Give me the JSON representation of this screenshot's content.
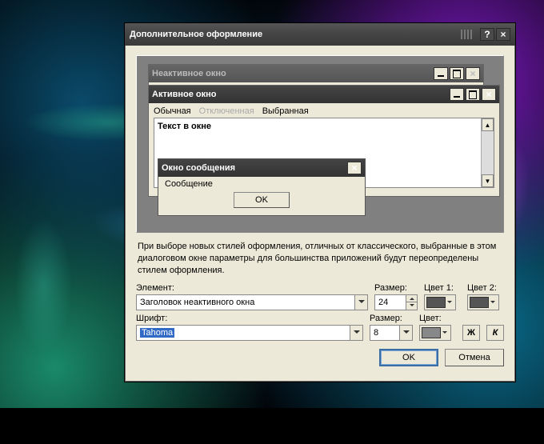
{
  "dialog": {
    "title": "Дополнительное оформление",
    "help": "?",
    "close": "×"
  },
  "preview": {
    "inactive_title": "Неактивное окно",
    "active_title": "Активное окно",
    "tab_normal": "Обычная",
    "tab_disabled": "Отключенная",
    "tab_selected": "Выбранная",
    "text_in_window": "Текст в окне",
    "msgbox_title": "Окно сообщения",
    "msgbox_text": "Сообщение",
    "msgbox_ok": "OK"
  },
  "info": "При выборе новых стилей оформления, отличных от классического, выбранные в этом диалоговом окне параметры для большинства приложений будут переопределены стилем оформления.",
  "labels": {
    "element": "Элемент:",
    "size": "Размер:",
    "color1": "Цвет 1:",
    "color2": "Цвет 2:",
    "font": "Шрифт:",
    "fsize": "Размер:",
    "fcolor": "Цвет:"
  },
  "values": {
    "element": "Заголовок неактивного окна",
    "size": "24",
    "font": "Tahoma",
    "fsize": "8",
    "bold": "Ж",
    "italic": "К"
  },
  "colors": {
    "c1": "#555555",
    "c2": "#6a6a6a",
    "fc": "#888888"
  },
  "buttons": {
    "ok": "OK",
    "cancel": "Отмена"
  }
}
